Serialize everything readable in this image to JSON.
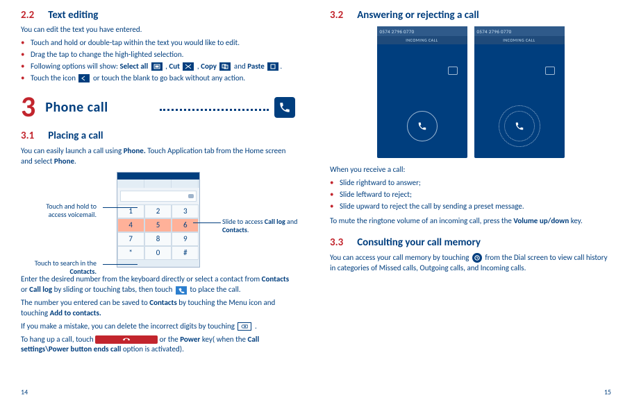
{
  "left": {
    "sec22_num": "2.2",
    "sec22_title": "Text editing",
    "sec22_intro": "You can edit the text you have entered.",
    "sec22_b1": "Touch and hold or double-tap within the text you would like to edit.",
    "sec22_b2": "Drag the tap to change the high-lighted selection.",
    "sec22_b3a": "Following options will show: ",
    "sec22_b3_selectall": "Select all",
    "sec22_b3_cut": "Cut",
    "sec22_b3_copy": "Copy",
    "sec22_b3_paste": "Paste",
    "sec22_b4a": "Touch the icon ",
    "sec22_b4b": " or touch the blank to go back without any action.",
    "chapter_num": "3",
    "chapter_title": "Phone call",
    "sec31_num": "3.1",
    "sec31_title": "Placing a call",
    "sec31_p1a": "You can easily launch a call using ",
    "sec31_p1_phone": "Phone.",
    "sec31_p1b": " Touch Application tab from the Home screen and select ",
    "sec31_p1_phone2": "Phone",
    "callout_left1": "Touch and hold to access voicemail.",
    "callout_left2a": "Touch to search in the ",
    "callout_left2b": "Contacts.",
    "callout_right1a": "Slide to access ",
    "callout_right1b": "Call log",
    "callout_right1c": " and ",
    "callout_right1d": "Contacts",
    "keys": [
      "1",
      "2",
      "3",
      "4",
      "5",
      "6",
      "7",
      "8",
      "9",
      "*",
      "0",
      "#"
    ],
    "sec31_p2a": "Enter the desired number from the keyboard directly or select a contact from ",
    "sec31_p2_contacts": "Contacts",
    "sec31_p2b": " or ",
    "sec31_p2_calllog": "Call log",
    "sec31_p2c": " by sliding or touching tabs, then touch ",
    "sec31_p2d": " to place the call.",
    "sec31_p3a": "The number you entered can be saved to ",
    "sec31_p3_contacts": "Contacts",
    "sec31_p3b": " by touching the Menu icon and touching ",
    "sec31_p3_add": "Add to contacts.",
    "sec31_p4a": "If you make a mistake, you can delete the incorrect digits by touching ",
    "sec31_p5a": "To hang up a call, touch ",
    "sec31_p5b": " or the ",
    "sec31_p5_power": "Power",
    "sec31_p5c": " key( when the ",
    "sec31_p5_setting": "Call settings\\Power button ends call",
    "sec31_p5d": " option is activated).",
    "page_num": "14"
  },
  "right": {
    "sec32_num": "3.2",
    "sec32_title": "Answering or rejecting a call",
    "call_number": "0574 2796 0770",
    "incoming": "INCOMING CALL",
    "sec32_p1": "When you receive a call:",
    "sec32_b1": "Slide rightward to answer;",
    "sec32_b2": "Slide leftward to reject;",
    "sec32_b3": "Slide upward to reject the call by sending a preset message.",
    "sec32_p2a": "To mute the ringtone volume of an incoming call, press the ",
    "sec32_p2_vol": "Volume up/down",
    "sec32_p2b": " key.",
    "sec33_num": "3.3",
    "sec33_title": "Consulting your call memory",
    "sec33_p1a": "You can access your call memory by touching ",
    "sec33_p1b": " from the Dial screen to view call history in categories of Missed calls, Outgoing calls, and Incoming calls.",
    "page_num": "15"
  }
}
